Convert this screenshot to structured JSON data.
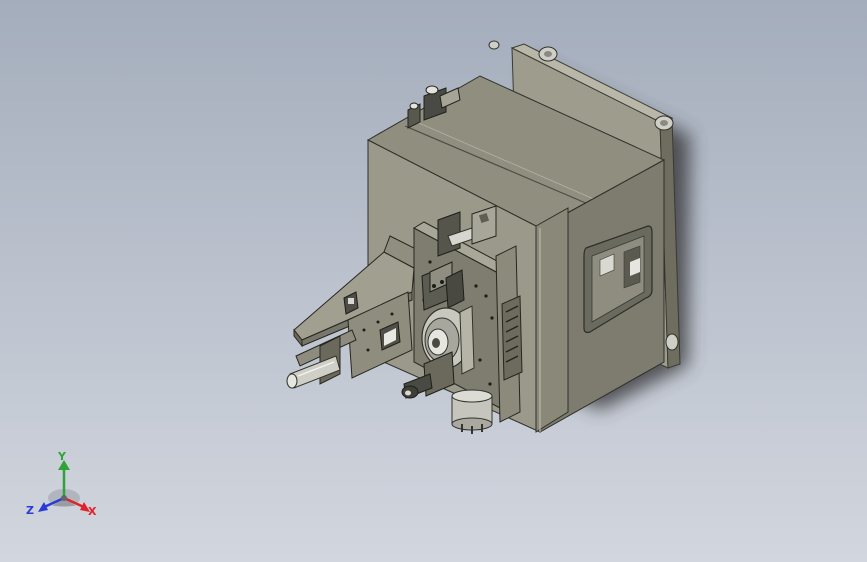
{
  "viewport": {
    "background_top": "#a4adbc",
    "background_bottom": "#d2d6de"
  },
  "model": {
    "body_color": "#8d8c7c",
    "shadow_color": "#3c3c40"
  },
  "triad": {
    "labels": {
      "x": "X",
      "y": "Y",
      "z": "Z"
    },
    "colors": {
      "x": "#e0222a",
      "y": "#2fa33a",
      "z": "#2a3bd8"
    }
  }
}
